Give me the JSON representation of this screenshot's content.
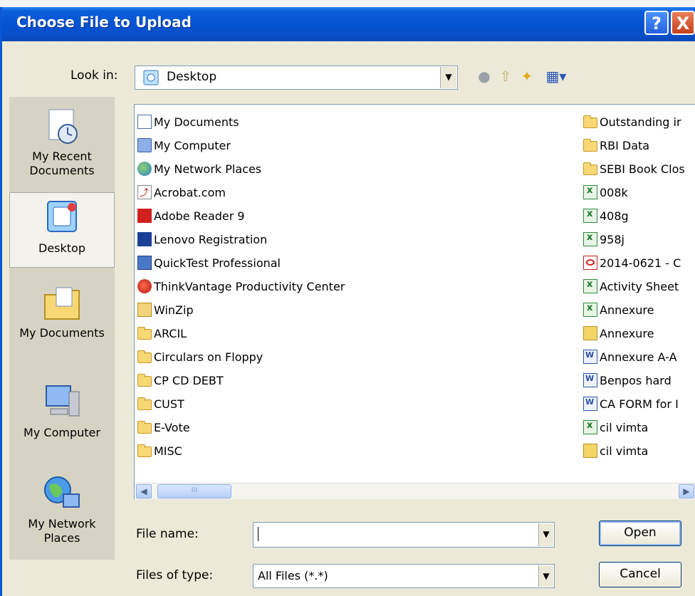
{
  "dialog": {
    "title": "Choose File to Upload",
    "help_label": "?",
    "close_label": "X"
  },
  "toolbar": {
    "look_in_label": "Look in:",
    "look_in_value": "Desktop"
  },
  "places": [
    {
      "label": "My Recent\nDocuments",
      "icon": "recent-documents-icon"
    },
    {
      "label": "Desktop",
      "icon": "desktop-icon",
      "selected": true
    },
    {
      "label": "My Documents",
      "icon": "my-documents-icon"
    },
    {
      "label": "My Computer",
      "icon": "my-computer-icon"
    },
    {
      "label": "My Network\nPlaces",
      "icon": "network-places-icon"
    }
  ],
  "files_left": [
    {
      "name": "My Documents",
      "icon": "doc"
    },
    {
      "name": "My Computer",
      "icon": "computer"
    },
    {
      "name": "My Network Places",
      "icon": "network"
    },
    {
      "name": "Acrobat.com",
      "icon": "shortcut-a"
    },
    {
      "name": "Adobe Reader 9",
      "icon": "adobe"
    },
    {
      "name": "Lenovo Registration",
      "icon": "lenovo"
    },
    {
      "name": "QuickTest Professional",
      "icon": "qtp"
    },
    {
      "name": "ThinkVantage Productivity Center",
      "icon": "think"
    },
    {
      "name": "WinZip",
      "icon": "zip"
    },
    {
      "name": "ARCIL",
      "icon": "folder"
    },
    {
      "name": "Circulars on Floppy",
      "icon": "folder"
    },
    {
      "name": "CP CD DEBT",
      "icon": "folder"
    },
    {
      "name": "CUST",
      "icon": "folder"
    },
    {
      "name": "E-Vote",
      "icon": "folder"
    },
    {
      "name": "MISC",
      "icon": "folder"
    }
  ],
  "files_right": [
    {
      "name": "Outstanding ir",
      "icon": "folder"
    },
    {
      "name": "RBI Data",
      "icon": "folder"
    },
    {
      "name": "SEBI Book Clos",
      "icon": "folder"
    },
    {
      "name": "008k",
      "icon": "xls"
    },
    {
      "name": "408g",
      "icon": "xls"
    },
    {
      "name": "958j",
      "icon": "xls"
    },
    {
      "name": "2014-0621 - C",
      "icon": "pdf"
    },
    {
      "name": "Activity Sheet",
      "icon": "xls"
    },
    {
      "name": "Annexure",
      "icon": "xls"
    },
    {
      "name": "Annexure",
      "icon": "anx"
    },
    {
      "name": "Annexure A-A",
      "icon": "word"
    },
    {
      "name": "Benpos hard",
      "icon": "word"
    },
    {
      "name": "CA FORM for I",
      "icon": "word"
    },
    {
      "name": "cil vimta",
      "icon": "xls"
    },
    {
      "name": "cil vimta",
      "icon": "anx"
    }
  ],
  "scrollbar": {
    "thumb_grip": "III",
    "left_arrow": "◀",
    "right_arrow": "▶"
  },
  "form": {
    "file_name_label": "File name:",
    "file_name_value": "",
    "files_of_type_label": "Files of type:",
    "files_of_type_value": "All Files (*.*)",
    "open_label": "Open",
    "cancel_label": "Cancel"
  },
  "colors": {
    "titlebar": "#0552d2",
    "dialog_bg": "#ece9d8",
    "places_bg": "#d6d3c4"
  }
}
